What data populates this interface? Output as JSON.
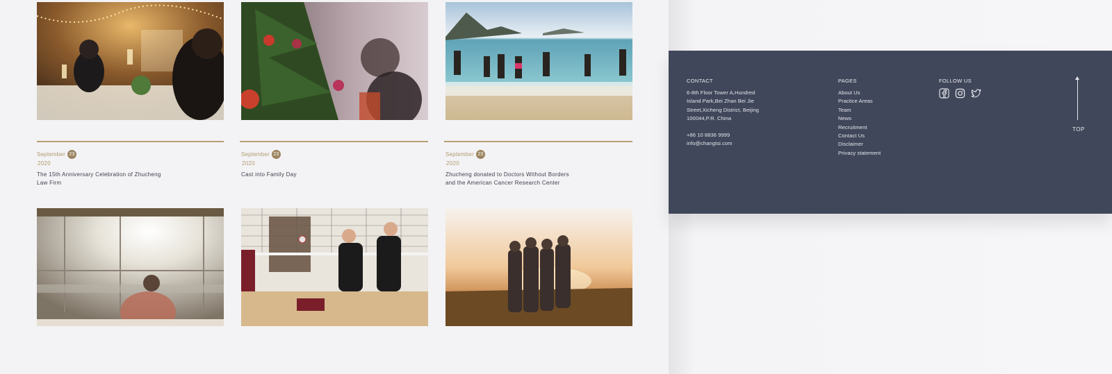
{
  "news": [
    {
      "month": "September",
      "day": "23",
      "year": "2020",
      "title_lines": [
        "The 15th Anniversary Celebration of Zhucheng",
        "Law Firm"
      ],
      "image": "party-celebration-photo"
    },
    {
      "month": "September",
      "day": "23",
      "year": "2020",
      "title_lines": [
        "Cast into Family Day",
        ""
      ],
      "image": "christmas-tree-photo"
    },
    {
      "month": "September",
      "day": "23",
      "year": "2020",
      "title_lines": [
        "Zhucheng donated to Doctors Without Borders",
        "and the American Cancer Research Center"
      ],
      "image": "beach-run-photo"
    }
  ],
  "gallery": [
    "sunlit-office-photo",
    "volleyball-photo",
    "friends-sunset-photo"
  ],
  "footer": {
    "contact": {
      "heading": "CONTACT",
      "address_lines": [
        "6-8th Floor Tower A,Hundred",
        "Island Park,Bei Zhan Bei Jie",
        "Street,Xicheng District, Beijing",
        "100044,P.R. China"
      ],
      "phone": "+86 10 8836 9999",
      "email": "info@changtsi.com"
    },
    "pages": {
      "heading": "PAGES",
      "links": [
        "About Us",
        "Practice Areas",
        "Team",
        "News",
        "Recruitment",
        "Contact Us",
        "Disclaimer",
        "Privacy statement"
      ]
    },
    "follow": {
      "heading": "FOLLOW US",
      "icons": [
        "facebook-icon",
        "instagram-icon",
        "twitter-icon"
      ]
    },
    "top_label": "TOP"
  },
  "colors": {
    "accent": "#b0996f",
    "footer_bg": "#41475a",
    "page_bg": "#f3f3f5"
  }
}
